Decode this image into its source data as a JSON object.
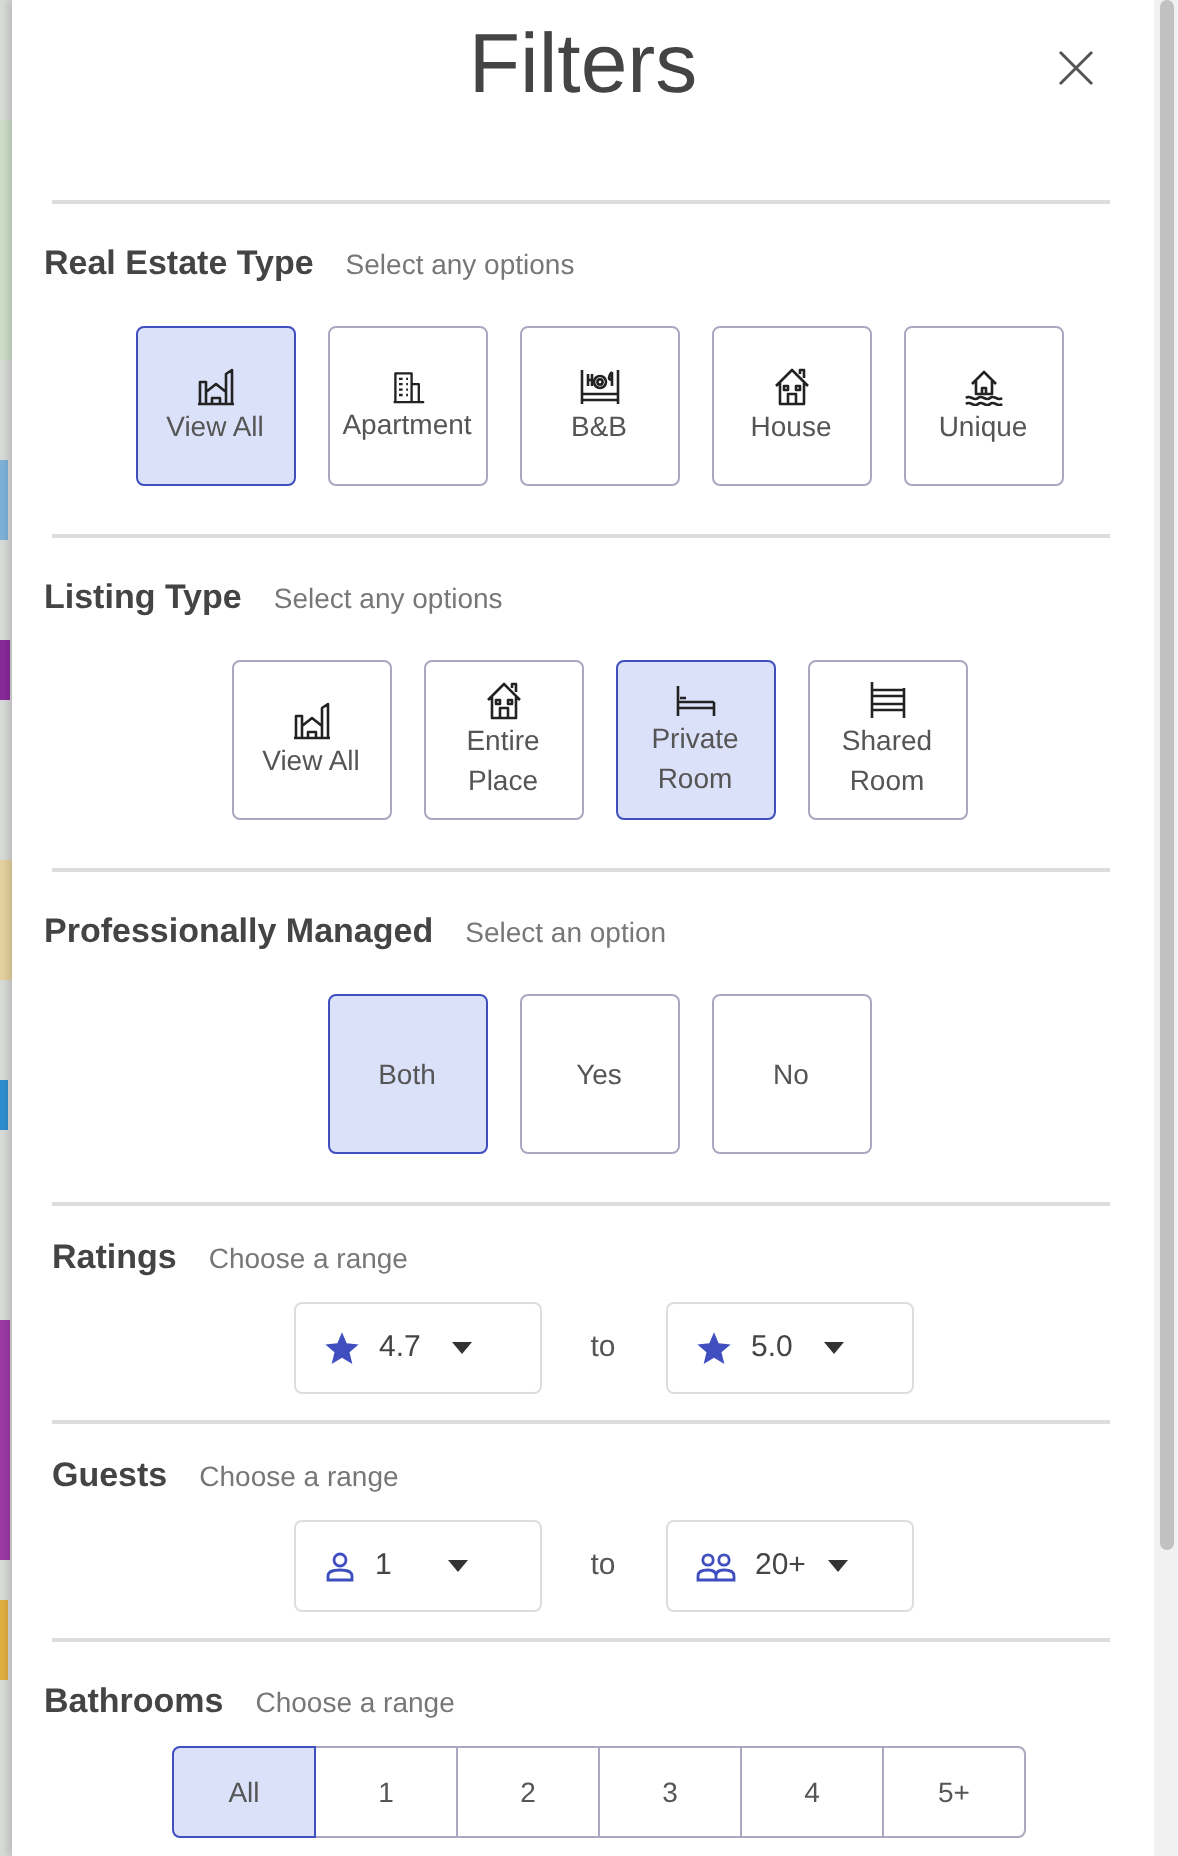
{
  "title": "Filters",
  "sections": [
    {
      "kind": "tiles",
      "heading": "Real Estate Type",
      "hint": "Select any options",
      "options": [
        {
          "label": "View All",
          "selected": true
        },
        {
          "label": "Apartment",
          "selected": false
        },
        {
          "label": "B&B",
          "selected": false
        },
        {
          "label": "House",
          "selected": false
        },
        {
          "label": "Unique",
          "selected": false
        }
      ]
    },
    {
      "kind": "tiles",
      "heading": "Listing Type",
      "hint": "Select any options",
      "options": [
        {
          "label": "View All",
          "selected": false
        },
        {
          "label": "Entire Place",
          "selected": false
        },
        {
          "label": "Private Room",
          "selected": true
        },
        {
          "label": "Shared Room",
          "selected": false
        }
      ]
    },
    {
      "kind": "tiles",
      "heading": "Professionally Managed",
      "hint": "Select an option",
      "options": [
        {
          "label": "Both",
          "selected": true
        },
        {
          "label": "Yes",
          "selected": false
        },
        {
          "label": "No",
          "selected": false
        }
      ]
    },
    {
      "kind": "rating-range",
      "heading": "Ratings",
      "hint": "Choose a range",
      "from": "4.7",
      "separator": "to",
      "to": "5.0"
    },
    {
      "kind": "guest-range",
      "heading": "Guests",
      "hint": "Choose a range",
      "from": "1",
      "separator": "to",
      "to": "20+"
    },
    {
      "kind": "segments",
      "heading": "Bathrooms",
      "hint": "Choose a range",
      "options": [
        {
          "label": "All",
          "selected": true
        },
        {
          "label": "1",
          "selected": false
        },
        {
          "label": "2",
          "selected": false
        },
        {
          "label": "3",
          "selected": false
        },
        {
          "label": "4",
          "selected": false
        },
        {
          "label": "5+",
          "selected": false
        }
      ]
    }
  ]
}
